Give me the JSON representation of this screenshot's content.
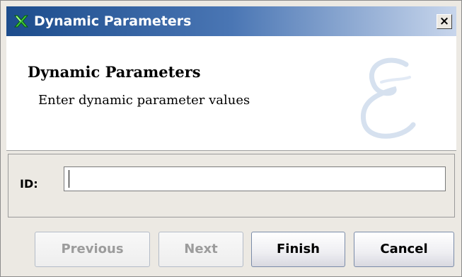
{
  "window": {
    "title": "Dynamic Parameters",
    "close_label": "×"
  },
  "header": {
    "title": "Dynamic Parameters",
    "subtitle": "Enter dynamic parameter values"
  },
  "form": {
    "id_label": "ID:",
    "id_value": "",
    "id_placeholder": ""
  },
  "buttons": {
    "previous": "Previous",
    "next": "Next",
    "finish": "Finish",
    "cancel": "Cancel"
  },
  "icons": {
    "title": "app-logo-icon",
    "close": "close-icon",
    "watermark": "script-e-watermark"
  },
  "colors": {
    "titlebar_start": "#1c4c8c",
    "titlebar_end": "#c8d6ec",
    "window_bg": "#ece9e3",
    "disabled_text": "#9c9c9c"
  },
  "state": {
    "previous_enabled": false,
    "next_enabled": false,
    "finish_enabled": true,
    "cancel_enabled": true
  }
}
